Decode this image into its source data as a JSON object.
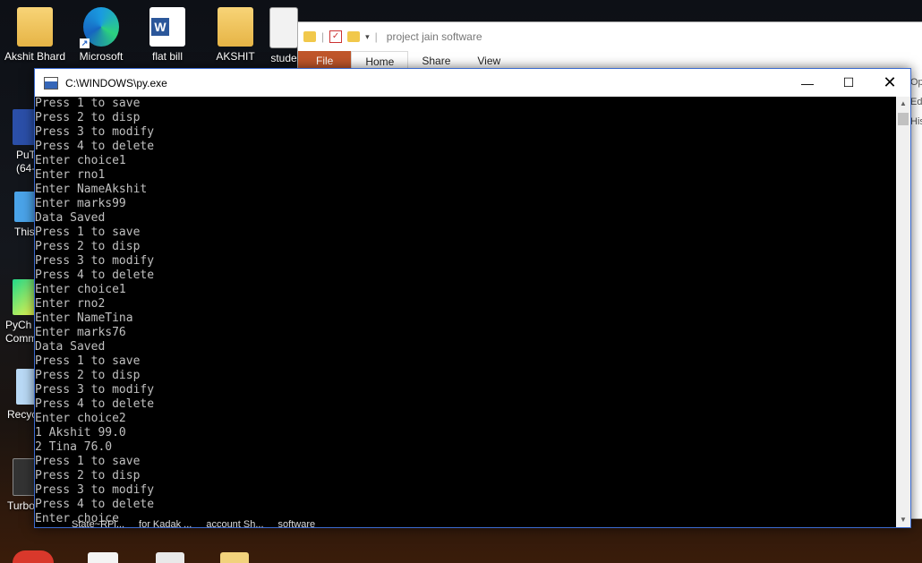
{
  "desktop": {
    "top_icons": [
      {
        "label": "Akshit Bhard",
        "icon": "user-folder-icon"
      },
      {
        "label": "Microsoft",
        "icon": "edge-icon"
      },
      {
        "label": "flat bill",
        "icon": "word-doc-icon"
      },
      {
        "label": "AKSHIT",
        "icon": "folder-icon"
      },
      {
        "label": "stude",
        "icon": "document-icon"
      }
    ],
    "side_icons": [
      {
        "label": "PuT (64-",
        "icon": "putty-icon"
      },
      {
        "label": "This",
        "icon": "computer-icon"
      },
      {
        "label": "PyCh Comm",
        "icon": "pycharm-icon"
      },
      {
        "label": "Recyc",
        "icon": "recycle-bin-icon"
      },
      {
        "label": "Turbo",
        "icon": "turbo-icon"
      }
    ],
    "bottom_labels": [
      "State~RPi...",
      "for Kadak ...",
      "account Sh...",
      "software"
    ]
  },
  "explorer": {
    "title": "project jain software",
    "ribbon_tabs": [
      "File",
      "Home",
      "Share",
      "View"
    ],
    "right_edge_text": [
      "Op",
      "Edi",
      "His"
    ]
  },
  "console": {
    "title": "C:\\WINDOWS\\py.exe",
    "lines": [
      "Press 1 to save",
      "Press 2 to disp",
      "Press 3 to modify",
      "Press 4 to delete",
      "Enter choice1",
      "Enter rno1",
      "Enter NameAkshit",
      "Enter marks99",
      "Data Saved",
      "Press 1 to save",
      "Press 2 to disp",
      "Press 3 to modify",
      "Press 4 to delete",
      "Enter choice1",
      "Enter rno2",
      "Enter NameTina",
      "Enter marks76",
      "Data Saved",
      "Press 1 to save",
      "Press 2 to disp",
      "Press 3 to modify",
      "Press 4 to delete",
      "Enter choice2",
      "1 Akshit 99.0",
      "2 Tina 76.0",
      "Press 1 to save",
      "Press 2 to disp",
      "Press 3 to modify",
      "Press 4 to delete",
      "Enter choice"
    ],
    "controls": {
      "minimize": "—",
      "maximize": "☐",
      "close": "✕"
    }
  }
}
